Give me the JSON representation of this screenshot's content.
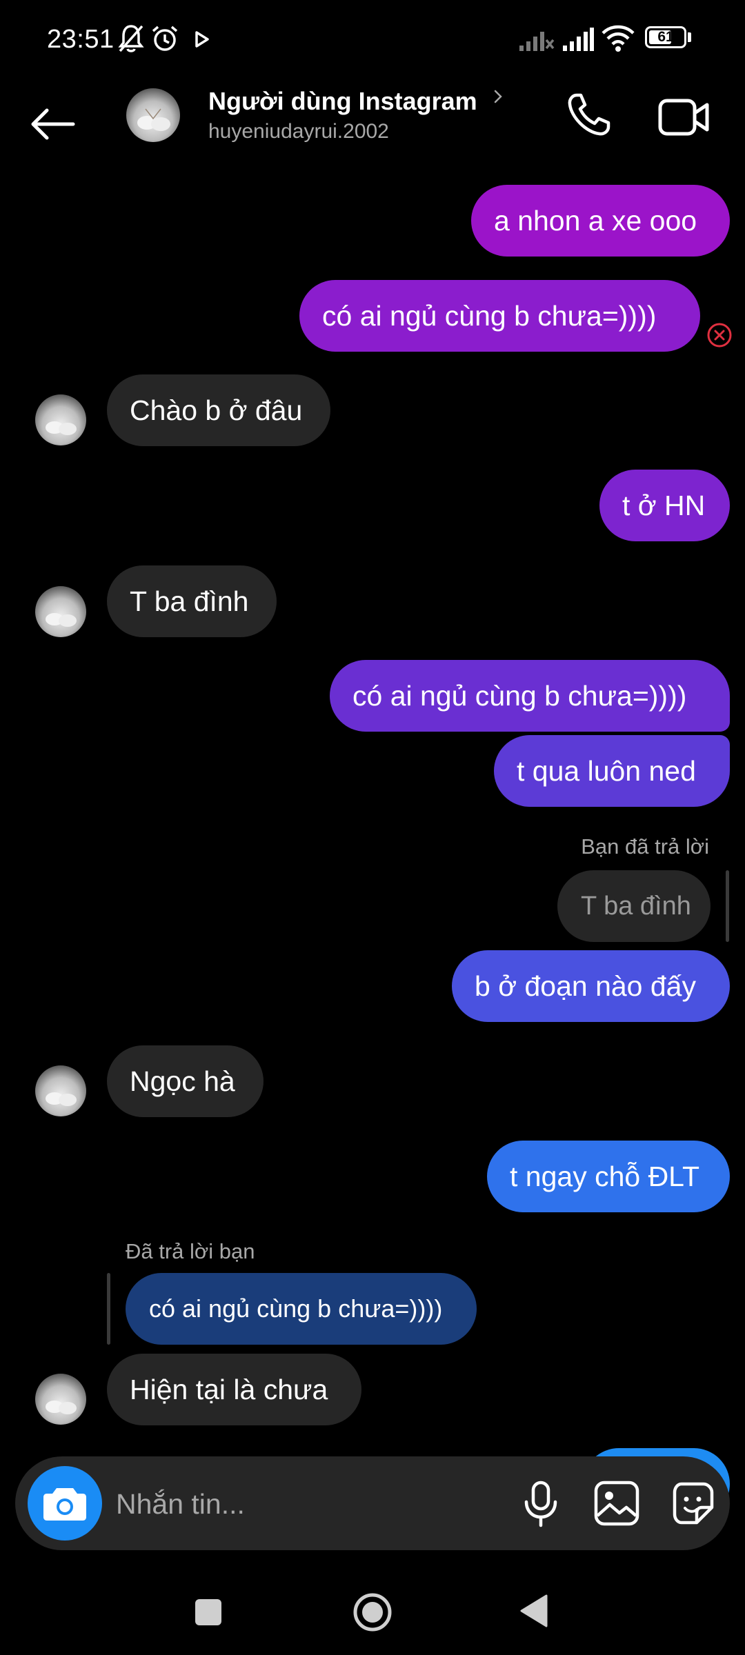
{
  "status_bar": {
    "time": "23:51",
    "battery": "61",
    "icons": [
      "mute-bell-icon",
      "alarm-icon",
      "play-icon",
      "signal-icon",
      "signal-icon",
      "wifi-icon",
      "battery-icon"
    ]
  },
  "header": {
    "contact_name": "Người dùng Instagram",
    "handle": "huyeniudayrui.2002",
    "icons": [
      "back-arrow-icon",
      "chevron-right-icon",
      "phone-icon",
      "video-icon"
    ]
  },
  "messages": [
    {
      "from": "me",
      "text": "a nhon a xe ooo"
    },
    {
      "from": "me",
      "text": "có ai ngủ cùng b chưa=))))",
      "status": "failed"
    },
    {
      "from": "them",
      "text": "Chào b ở đâu"
    },
    {
      "from": "me",
      "text": "t ở HN"
    },
    {
      "from": "them",
      "text": "T ba đình"
    },
    {
      "from": "me",
      "text": "có ai ngủ cùng b chưa=))))"
    },
    {
      "from": "me",
      "text": "t qua luôn ned"
    },
    {
      "from": "me",
      "reply_label": "Bạn đã trả lời",
      "quoted": "T ba đình",
      "text": "b ở đoạn nào đấy"
    },
    {
      "from": "them",
      "text": "Ngọc hà"
    },
    {
      "from": "me",
      "text": "t ngay chỗ ĐLT"
    },
    {
      "from": "them",
      "reply_label": "Đã trả lời bạn",
      "quoted": "có ai ngủ cùng b chưa=))))",
      "text": "Hiện tại là chưa"
    }
  ],
  "composer": {
    "placeholder": "Nhắn tin...",
    "icons": [
      "camera-icon",
      "microphone-icon",
      "gallery-icon",
      "sticker-icon"
    ]
  },
  "nav": {
    "icons": [
      "recents-icon",
      "home-icon",
      "back-icon"
    ]
  },
  "colors": {
    "background": "#000000",
    "incoming_bubble": "#262626",
    "outgoing_gradient": [
      "#9b14c9",
      "#6a2fd2",
      "#4a52e0",
      "#2f72ec",
      "#1e8cf2"
    ],
    "accent_blue": "#1a8cf5",
    "error_red": "#e03040"
  }
}
